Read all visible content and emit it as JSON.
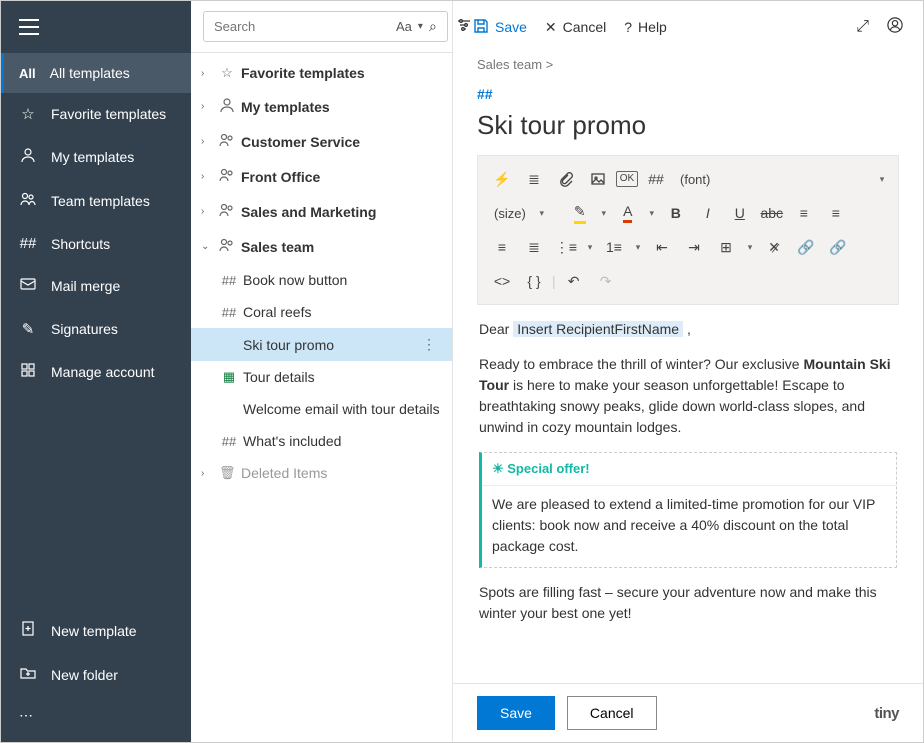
{
  "sidebar": {
    "items": [
      {
        "badge": "All",
        "label": "All templates"
      },
      {
        "icon": "star",
        "label": "Favorite templates"
      },
      {
        "icon": "person",
        "label": "My templates"
      },
      {
        "icon": "people",
        "label": "Team templates"
      },
      {
        "icon": "hash",
        "label": "Shortcuts"
      },
      {
        "icon": "mail",
        "label": "Mail merge"
      },
      {
        "icon": "pen",
        "label": "Signatures"
      },
      {
        "icon": "grid",
        "label": "Manage account"
      }
    ],
    "bottom": [
      {
        "icon": "newdoc",
        "label": "New template"
      },
      {
        "icon": "newfolder",
        "label": "New folder"
      }
    ]
  },
  "search": {
    "placeholder": "Search",
    "aa": "Aa"
  },
  "tree": [
    {
      "type": "folder",
      "icon": "star",
      "label": "Favorite templates",
      "bold": true
    },
    {
      "type": "folder",
      "icon": "person",
      "label": "My templates",
      "bold": true
    },
    {
      "type": "folder",
      "icon": "people",
      "label": "Customer Service",
      "bold": true
    },
    {
      "type": "folder",
      "icon": "people",
      "label": "Front Office",
      "bold": true
    },
    {
      "type": "folder",
      "icon": "people",
      "label": "Sales and Marketing",
      "bold": true
    },
    {
      "type": "folder",
      "icon": "people",
      "label": "Sales team",
      "bold": true,
      "expanded": true
    },
    {
      "type": "item",
      "icon": "hash",
      "label": "Book now button"
    },
    {
      "type": "item",
      "icon": "hash",
      "label": "Coral reefs"
    },
    {
      "type": "item",
      "icon": "",
      "label": "Ski tour promo",
      "selected": true
    },
    {
      "type": "item",
      "icon": "xls",
      "label": "Tour details"
    },
    {
      "type": "item",
      "icon": "",
      "label": "Welcome email with tour details"
    },
    {
      "type": "item",
      "icon": "hash",
      "label": "What's included"
    },
    {
      "type": "folder",
      "icon": "trash",
      "label": "Deleted Items",
      "muted": true
    }
  ],
  "topbar": {
    "save": "Save",
    "cancel": "Cancel",
    "help": "Help"
  },
  "breadcrumb": "Sales team >",
  "hash": "##",
  "title": "Ski tour promo",
  "toolbar": {
    "font": "(font)",
    "size": "(size)"
  },
  "body": {
    "dear": "Dear ",
    "recipient": "Insert RecipientFirstName",
    "comma": " ,",
    "p1a": "Ready to embrace the thrill of winter? Our exclusive ",
    "p1b": "Mountain Ski Tour",
    "p1c": " is here to make your season unforgettable! Escape to breathtaking snowy peaks, glide down world-class slopes, and unwind in cozy mountain lodges.",
    "special_title": "☀ Special offer!",
    "special_body": "We are pleased to extend a limited-time promotion for our VIP clients: book now and receive a 40% discount on the total package cost.",
    "p2": "Spots are filling fast – secure your adventure now and make this winter your best one yet!"
  },
  "footer": {
    "save": "Save",
    "cancel": "Cancel",
    "tiny": "tiny"
  }
}
